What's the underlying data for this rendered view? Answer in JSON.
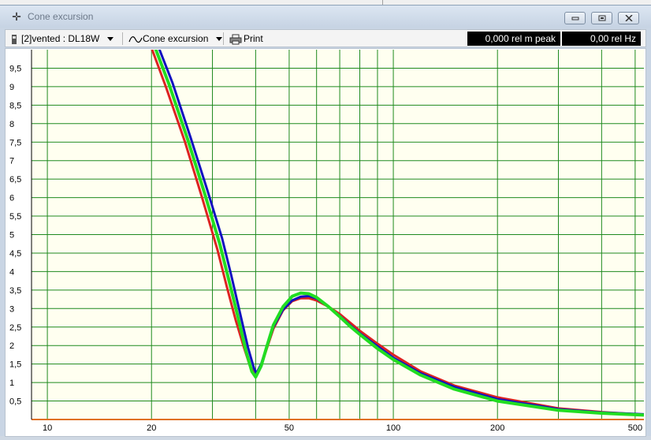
{
  "window": {
    "title": "Cone excursion",
    "app_icon": "crosshair-icon",
    "buttons": [
      "minimize-icon",
      "restore-icon",
      "close-icon"
    ]
  },
  "toolbar": {
    "device_label": "[2]vented : DL18W",
    "view_label": "Cone excursion",
    "print_label": "Print",
    "readout_value": "0,000 rel m peak",
    "readout_freq": "0,00 rel Hz"
  },
  "chart_data": {
    "type": "line",
    "x_scale": "log",
    "xlim": [
      9,
      530
    ],
    "ylim": [
      0,
      10
    ],
    "grid": true,
    "x_ticks": [
      {
        "value": 10,
        "label": "10"
      },
      {
        "value": 20,
        "label": "20"
      },
      {
        "value": 50,
        "label": "50"
      },
      {
        "value": 100,
        "label": "100"
      },
      {
        "value": 200,
        "label": "200"
      },
      {
        "value": 500,
        "label": "500"
      }
    ],
    "x_minor_gridlines": [
      30,
      40,
      60,
      70,
      80,
      90,
      300,
      400
    ],
    "y_ticks": [
      {
        "value": 0.5,
        "label": "0,5"
      },
      {
        "value": 1,
        "label": "1"
      },
      {
        "value": 1.5,
        "label": "1,5"
      },
      {
        "value": 2,
        "label": "2"
      },
      {
        "value": 2.5,
        "label": "2,5"
      },
      {
        "value": 3,
        "label": "3"
      },
      {
        "value": 3.5,
        "label": "3,5"
      },
      {
        "value": 4,
        "label": "4"
      },
      {
        "value": 4.5,
        "label": "4,5"
      },
      {
        "value": 5,
        "label": "5"
      },
      {
        "value": 5.5,
        "label": "5,5"
      },
      {
        "value": 6,
        "label": "6"
      },
      {
        "value": 6.5,
        "label": "6,5"
      },
      {
        "value": 7,
        "label": "7"
      },
      {
        "value": 7.5,
        "label": "7,5"
      },
      {
        "value": 8,
        "label": "8"
      },
      {
        "value": 8.5,
        "label": "8,5"
      },
      {
        "value": 9,
        "label": "9"
      },
      {
        "value": 9.5,
        "label": "9,5"
      }
    ],
    "colors": {
      "background": "#fffff0",
      "grid": "#1f8a1f",
      "baseline": "#e07020",
      "red": "#dd2222",
      "blue": "#1010c0",
      "green": "#22dd22"
    },
    "series": [
      {
        "color": "red",
        "x": [
          20,
          22,
          25,
          28,
          31,
          33,
          35,
          37,
          38.5,
          40,
          41.5,
          43,
          45,
          48,
          51,
          54,
          57,
          60,
          65,
          70,
          75,
          80,
          90,
          100,
          120,
          150,
          200,
          300,
          400,
          530
        ],
        "y": [
          10.05,
          9.0,
          7.5,
          6.0,
          4.6,
          3.6,
          2.7,
          1.95,
          1.45,
          1.2,
          1.45,
          1.9,
          2.45,
          2.95,
          3.2,
          3.28,
          3.28,
          3.22,
          3.05,
          2.85,
          2.62,
          2.4,
          2.05,
          1.75,
          1.3,
          0.92,
          0.6,
          0.3,
          0.2,
          0.13
        ]
      },
      {
        "color": "blue",
        "x": [
          21,
          23,
          26,
          29,
          32,
          34,
          36,
          38,
          39.5,
          40.2,
          41.5,
          43,
          45,
          48,
          51,
          54,
          57,
          60,
          65,
          70,
          75,
          80,
          90,
          100,
          120,
          150,
          200,
          300,
          400,
          530
        ],
        "y": [
          10.05,
          9.1,
          7.6,
          6.2,
          4.9,
          3.9,
          2.9,
          1.95,
          1.4,
          1.25,
          1.5,
          1.95,
          2.5,
          2.97,
          3.22,
          3.32,
          3.34,
          3.27,
          3.05,
          2.8,
          2.55,
          2.33,
          1.98,
          1.67,
          1.25,
          0.88,
          0.55,
          0.28,
          0.19,
          0.14
        ]
      },
      {
        "color": "green",
        "x": [
          20.5,
          22.5,
          25.5,
          28.5,
          31.5,
          33.5,
          35.5,
          37.5,
          39,
          40,
          41.5,
          43,
          45,
          48,
          51,
          54,
          57,
          60,
          65,
          70,
          75,
          80,
          90,
          100,
          120,
          150,
          200,
          300,
          400,
          530
        ],
        "y": [
          10.05,
          9.05,
          7.55,
          6.1,
          4.75,
          3.75,
          2.8,
          1.85,
          1.3,
          1.15,
          1.45,
          1.95,
          2.55,
          3.05,
          3.33,
          3.42,
          3.4,
          3.3,
          3.05,
          2.78,
          2.52,
          2.3,
          1.92,
          1.62,
          1.2,
          0.82,
          0.5,
          0.25,
          0.17,
          0.12
        ]
      }
    ]
  }
}
